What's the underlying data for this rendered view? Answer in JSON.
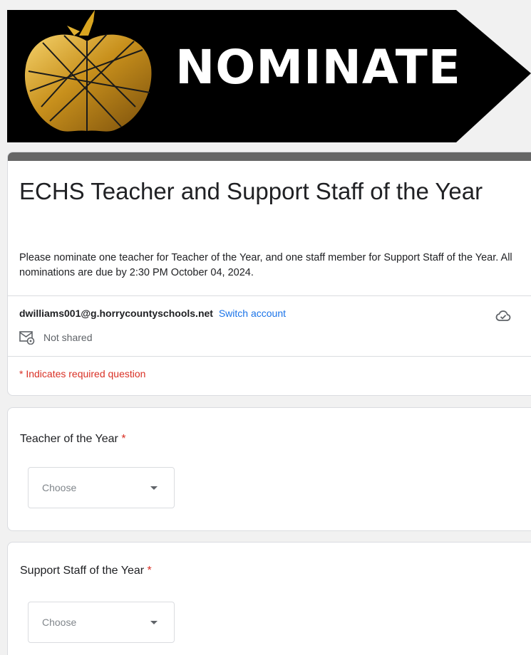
{
  "banner": {
    "title": "NOMINATE",
    "icon": "apple-icon",
    "background_color": "#000000",
    "accent_color": "#d4a017"
  },
  "form": {
    "title": "ECHS Teacher and Support Staff of the Year",
    "description": "Please nominate one teacher for Teacher of the Year, and one staff member for Support Staff of the Year. All nominations are due by 2:30 PM October 04, 2024.",
    "header_bar_color": "#666666"
  },
  "account": {
    "email": "dwilliams001@g.horrycountyschools.net",
    "switch_label": "Switch account",
    "cloud_icon": "cloud-check-icon",
    "shared_status": "Not shared",
    "shared_icon": "mail-settings-icon"
  },
  "required_note": "* Indicates required question",
  "questions": [
    {
      "title": "Teacher of the Year",
      "required_marker": "*",
      "dropdown_value": "Choose"
    },
    {
      "title": "Support Staff of the Year",
      "required_marker": "*",
      "dropdown_value": "Choose"
    }
  ],
  "colors": {
    "required": "#d93025",
    "link": "#1a73e8",
    "page_background": "#f1f1f1"
  }
}
